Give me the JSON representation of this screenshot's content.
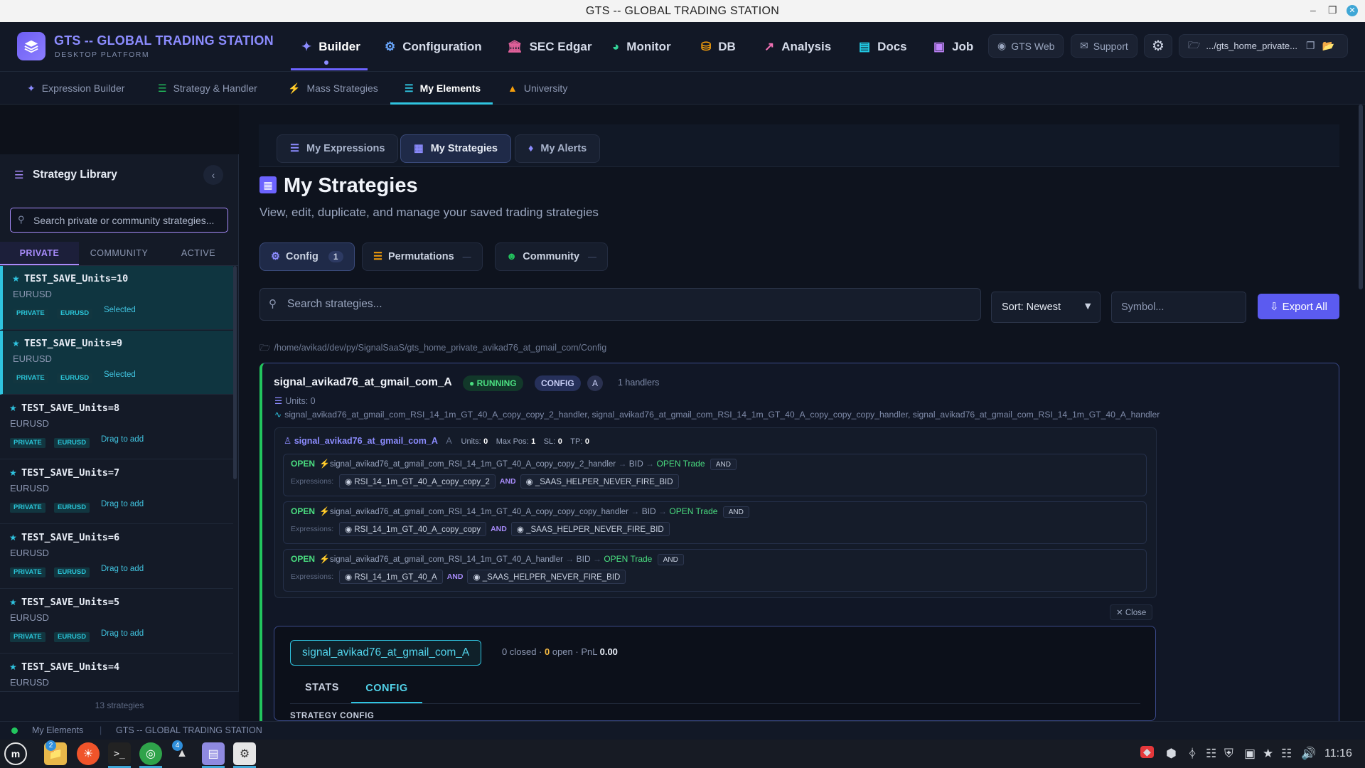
{
  "window": {
    "title": "GTS -- GLOBAL TRADING STATION"
  },
  "brand": {
    "name": "GTS -- GLOBAL TRADING STATION",
    "subtitle": "DESKTOP PLATFORM"
  },
  "nav": {
    "items": [
      {
        "label": "Builder",
        "icon": "wand-icon",
        "active": true
      },
      {
        "label": "Configuration",
        "icon": "gear-icon"
      },
      {
        "label": "SEC Edgar",
        "icon": "bank-icon"
      },
      {
        "label": "Monitor",
        "icon": "gauge-icon"
      },
      {
        "label": "DB",
        "icon": "database-icon"
      },
      {
        "label": "Analysis",
        "icon": "chart-line-icon"
      },
      {
        "label": "Docs",
        "icon": "book-icon"
      },
      {
        "label": "Job",
        "icon": "briefcase-icon"
      }
    ],
    "gts_web": "GTS Web",
    "support": "Support",
    "path": ".../gts_home_private..."
  },
  "subnav": {
    "items": [
      {
        "label": "Expression Builder"
      },
      {
        "label": "Strategy & Handler"
      },
      {
        "label": "Mass Strategies"
      },
      {
        "label": "My Elements",
        "active": true
      },
      {
        "label": "University"
      }
    ]
  },
  "sidebar": {
    "title": "Strategy Library",
    "search_placeholder": "Search private or community strategies...",
    "tabs": [
      {
        "label": "PRIVATE",
        "active": true
      },
      {
        "label": "COMMUNITY"
      },
      {
        "label": "ACTIVE"
      }
    ],
    "items": [
      {
        "name": "TEST_SAVE_Units=10",
        "symbol": "EURUSD",
        "tag1": "PRIVATE",
        "tag2": "EURUSD",
        "hint": "Selected",
        "selected": true
      },
      {
        "name": "TEST_SAVE_Units=9",
        "symbol": "EURUSD",
        "tag1": "PRIVATE",
        "tag2": "EURUSD",
        "hint": "Selected",
        "selected": true
      },
      {
        "name": "TEST_SAVE_Units=8",
        "symbol": "EURUSD",
        "tag1": "PRIVATE",
        "tag2": "EURUSD",
        "hint": "Drag to add"
      },
      {
        "name": "TEST_SAVE_Units=7",
        "symbol": "EURUSD",
        "tag1": "PRIVATE",
        "tag2": "EURUSD",
        "hint": "Drag to add"
      },
      {
        "name": "TEST_SAVE_Units=6",
        "symbol": "EURUSD",
        "tag1": "PRIVATE",
        "tag2": "EURUSD",
        "hint": "Drag to add"
      },
      {
        "name": "TEST_SAVE_Units=5",
        "symbol": "EURUSD",
        "tag1": "PRIVATE",
        "tag2": "EURUSD",
        "hint": "Drag to add"
      },
      {
        "name": "TEST_SAVE_Units=4",
        "symbol": "EURUSD"
      }
    ],
    "count": "13 strategies"
  },
  "main": {
    "tabs": [
      {
        "label": "My Expressions"
      },
      {
        "label": "My Strategies",
        "active": true
      },
      {
        "label": "My Alerts"
      }
    ],
    "title": "My Strategies",
    "subtitle": "View, edit, duplicate, and manage your saved trading strategies",
    "filter_tabs": [
      {
        "label": "Config",
        "count": "1",
        "active": true
      },
      {
        "label": "Permutations",
        "count": "—"
      },
      {
        "label": "Community",
        "count": "—"
      }
    ],
    "search_placeholder": "Search strategies...",
    "sort": "Sort: Newest",
    "symbol_placeholder": "Symbol...",
    "export": "Export All",
    "path": "/home/avikad/dev/py/SignalSaaS/gts_home_private_avikad76_at_gmail_com/Config"
  },
  "card": {
    "name": "signal_avikad76_at_gmail_com_A",
    "status": "RUNNING",
    "type": "CONFIG",
    "letter": "A",
    "handlers_count": "1 handlers",
    "units": "Units: 0",
    "handlers_line": "signal_avikad76_at_gmail_com_RSI_14_1m_GT_40_A_copy_copy_2_handler, signal_avikad76_at_gmail_com_RSI_14_1m_GT_40_A_copy_copy_copy_handler, signal_avikad76_at_gmail_com_RSI_14_1m_GT_40_A_handler",
    "inner": {
      "name": "signal_avikad76_at_gmail_com_A",
      "letter": "A",
      "units_label": "Units:",
      "units": "0",
      "maxpos_label": "Max Pos:",
      "maxpos": "1",
      "sl_label": "SL:",
      "sl": "0",
      "tp_label": "TP:",
      "tp": "0"
    },
    "handlers": [
      {
        "action": "OPEN",
        "name": "signal_avikad76_at_gmail_com_RSI_14_1m_GT_40_A_copy_copy_2_handler",
        "side": "BID",
        "trade": "OPEN Trade",
        "op": "AND",
        "expr_label": "Expressions:",
        "expr1": "RSI_14_1m_GT_40_A_copy_copy_2",
        "and": "AND",
        "expr2": "_SAAS_HELPER_NEVER_FIRE_BID"
      },
      {
        "action": "OPEN",
        "name": "signal_avikad76_at_gmail_com_RSI_14_1m_GT_40_A_copy_copy_copy_handler",
        "side": "BID",
        "trade": "OPEN Trade",
        "op": "AND",
        "expr_label": "Expressions:",
        "expr1": "RSI_14_1m_GT_40_A_copy_copy",
        "and": "AND",
        "expr2": "_SAAS_HELPER_NEVER_FIRE_BID"
      },
      {
        "action": "OPEN",
        "name": "signal_avikad76_at_gmail_com_RSI_14_1m_GT_40_A_handler",
        "side": "BID",
        "trade": "OPEN Trade",
        "op": "AND",
        "expr_label": "Expressions:",
        "expr1": "RSI_14_1m_GT_40_A",
        "and": "AND",
        "expr2": "_SAAS_HELPER_NEVER_FIRE_BID"
      }
    ],
    "close": "Close"
  },
  "detail": {
    "name": "signal_avikad76_at_gmail_com_A",
    "closed": "0 closed",
    "open_count": "0",
    "open_label": "open",
    "pnl_label": "PnL",
    "pnl": "0.00",
    "tabs": [
      {
        "label": "STATS"
      },
      {
        "label": "CONFIG",
        "active": true
      }
    ],
    "section": "STRATEGY CONFIG"
  },
  "statusbar": {
    "item1": "My Elements",
    "item2": "GTS -- GLOBAL TRADING STATION"
  },
  "taskbar": {
    "badge_files": "2",
    "badge_app": "4",
    "clock": "11:16"
  },
  "colors": {
    "accent": "#6c63ff",
    "cyan": "#2fc4e0",
    "green": "#22c55e",
    "bg": "#0e131e"
  }
}
